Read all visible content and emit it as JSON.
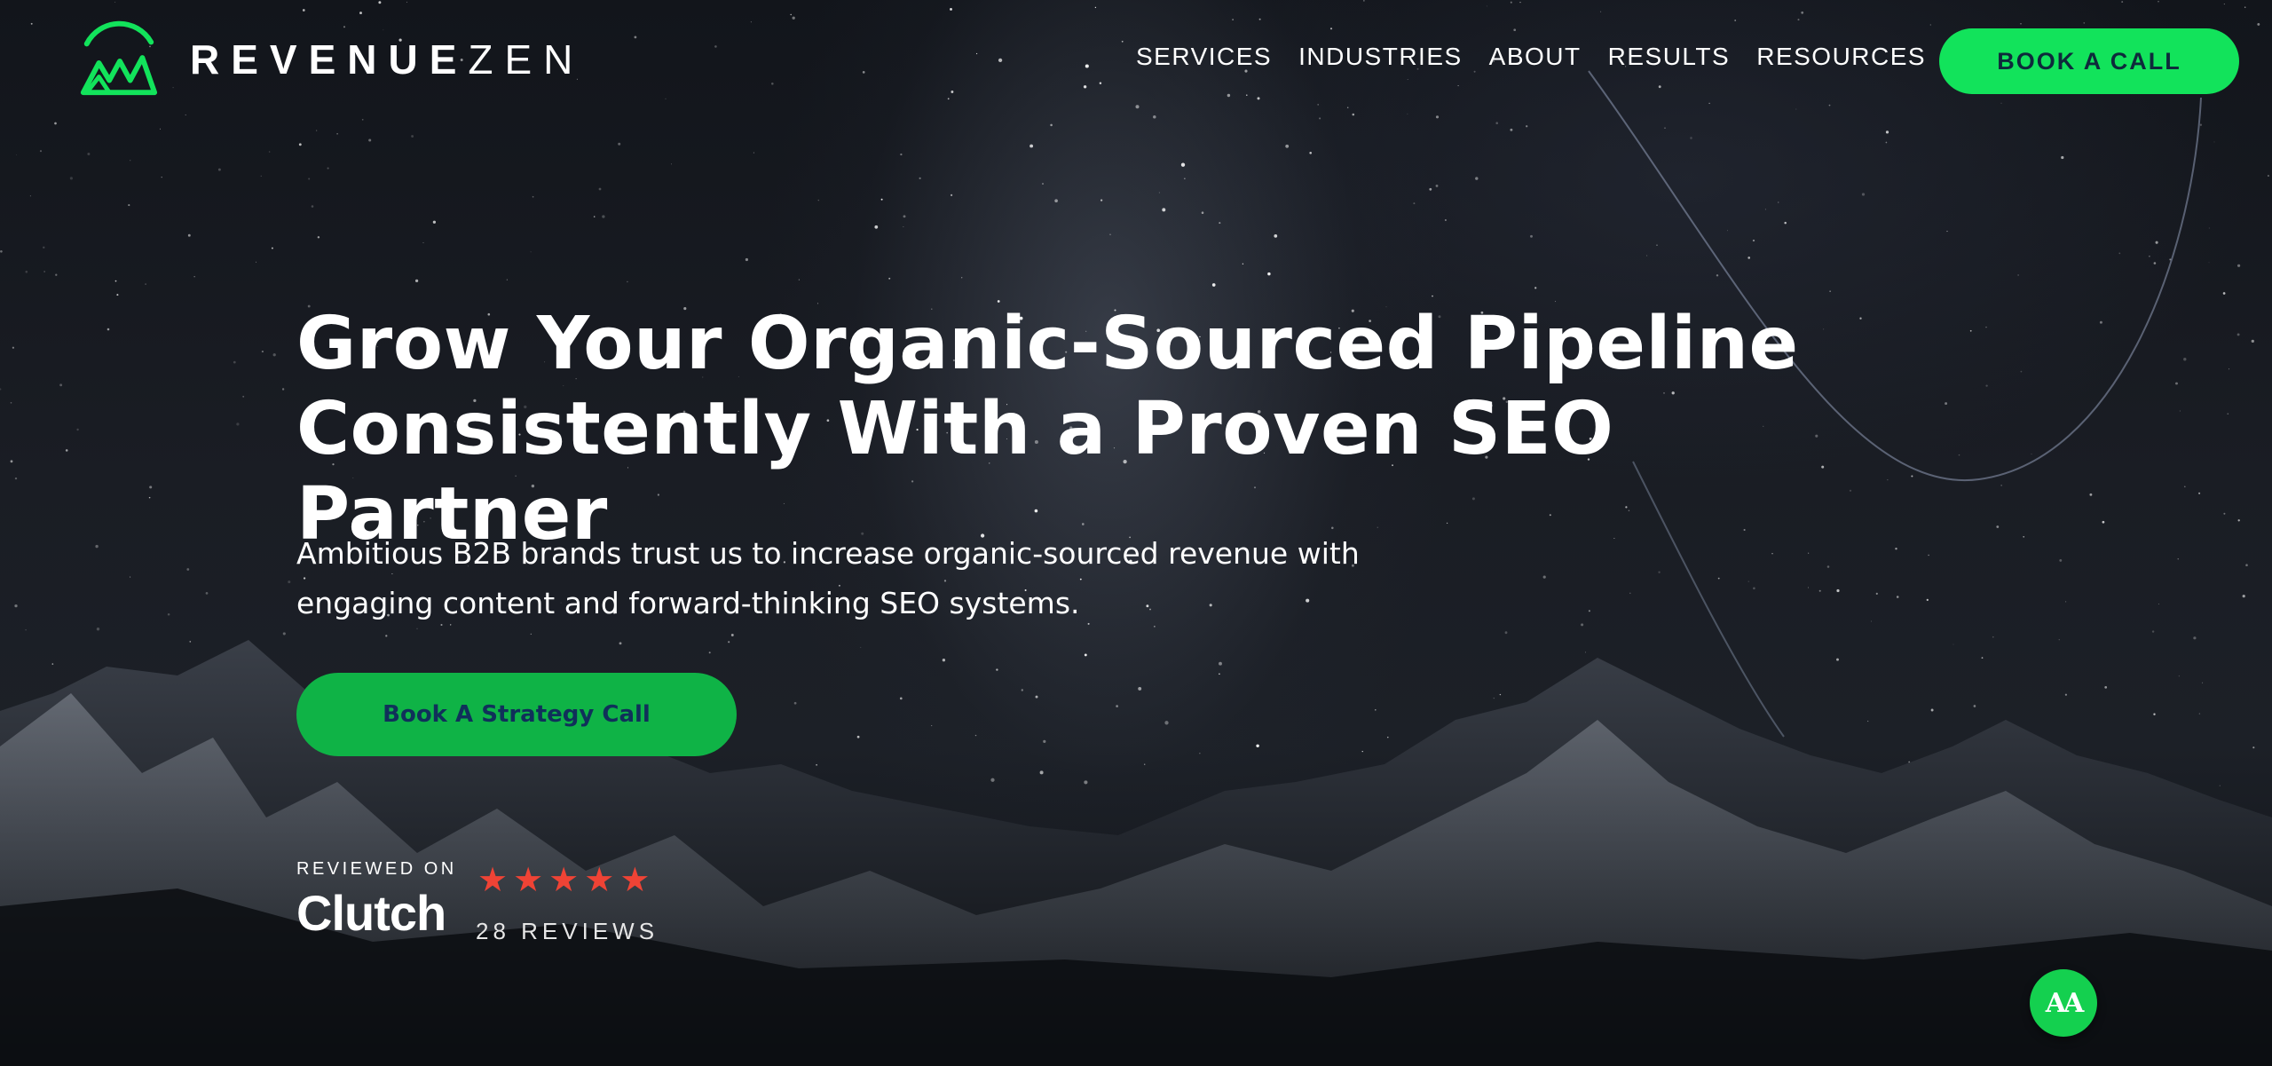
{
  "brand": {
    "name_left": "REVENUE",
    "name_right": "ZEN",
    "logo_icon": "mountain-peaks-icon",
    "accent_color": "#12e35b"
  },
  "nav": {
    "items": [
      {
        "label": "SERVICES"
      },
      {
        "label": "INDUSTRIES"
      },
      {
        "label": "ABOUT"
      },
      {
        "label": "RESULTS"
      },
      {
        "label": "RESOURCES"
      }
    ],
    "cta_label": "BOOK A CALL"
  },
  "hero": {
    "headline_line1": "Grow Your Organic-Sourced Pipeline",
    "headline_line2": "Consistently With a Proven SEO Partner",
    "subhead_line1": "Ambitious B2B brands trust us to increase organic-sourced revenue with",
    "subhead_line2": "engaging content and forward-thinking SEO systems.",
    "cta_label": "Book A Strategy Call"
  },
  "clutch": {
    "reviewed_on": "REVIEWED ON",
    "brand_text": "Clutch",
    "rating_stars": 5,
    "reviews_label": "28 REVIEWS",
    "star_color": "#ef4335"
  },
  "accessibility": {
    "label": "AA",
    "icon": "accessibility-text-size-icon"
  }
}
